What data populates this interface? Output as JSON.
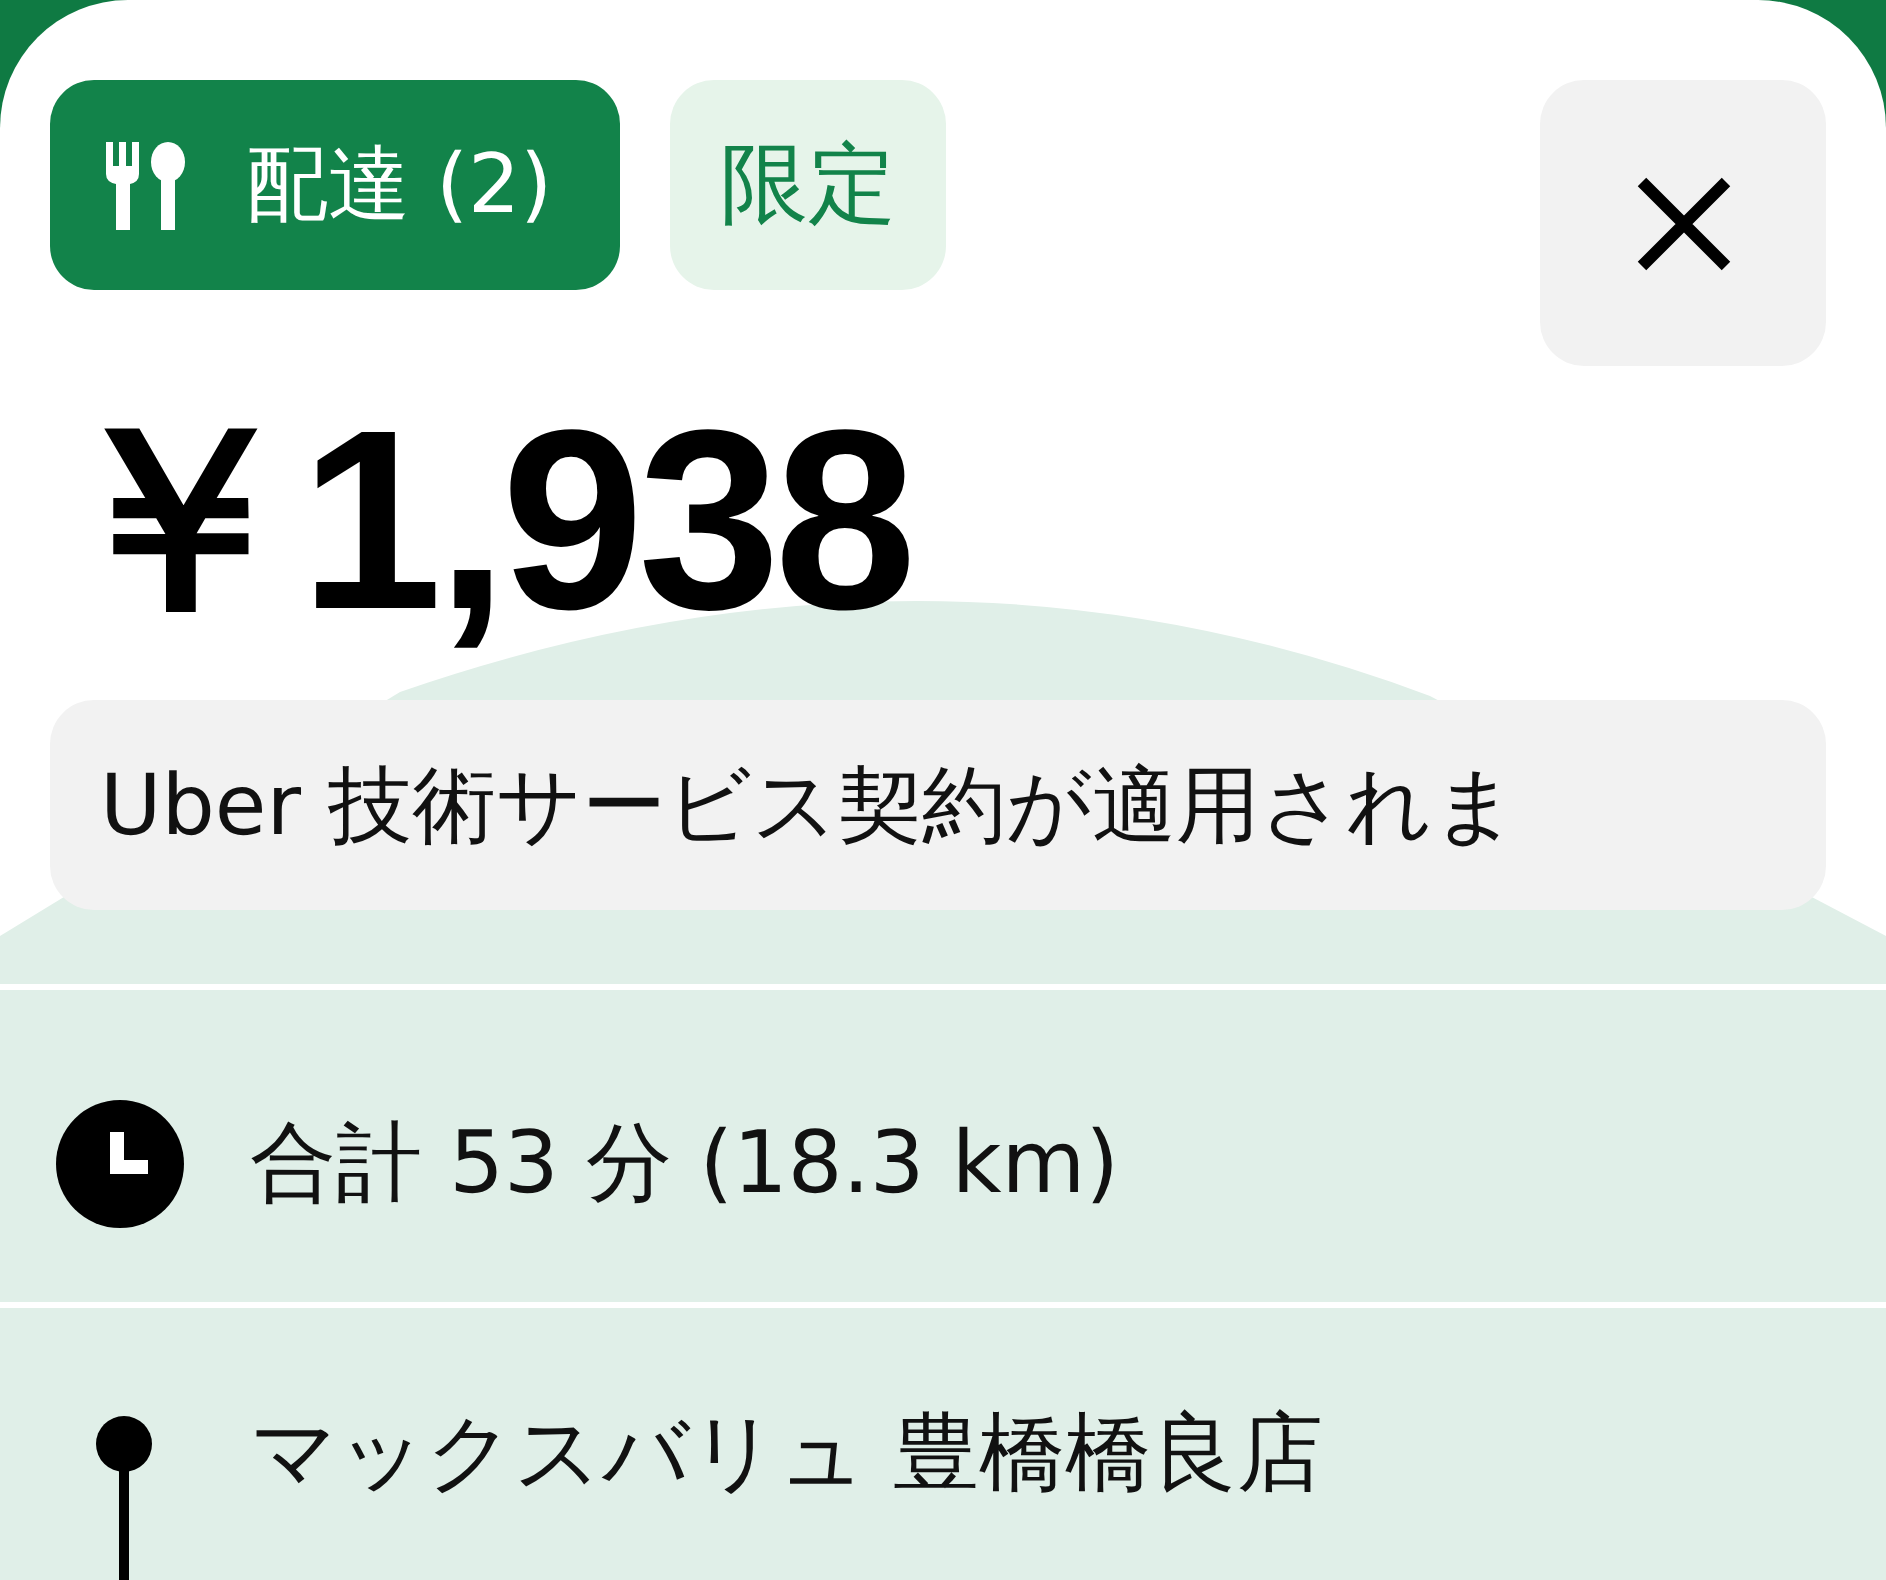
{
  "tags": [
    {
      "kind": "delivery",
      "label": "配達 (2)"
    },
    {
      "kind": "limited",
      "label": "限定"
    }
  ],
  "price": "￥1,938",
  "notice": "Uber 技術サービス契約が適用されま",
  "route": {
    "summary": "合計 53 分 (18.3 km)",
    "stops": [
      {
        "name": "マックスバリュ 豊橋橋良店"
      }
    ]
  }
}
